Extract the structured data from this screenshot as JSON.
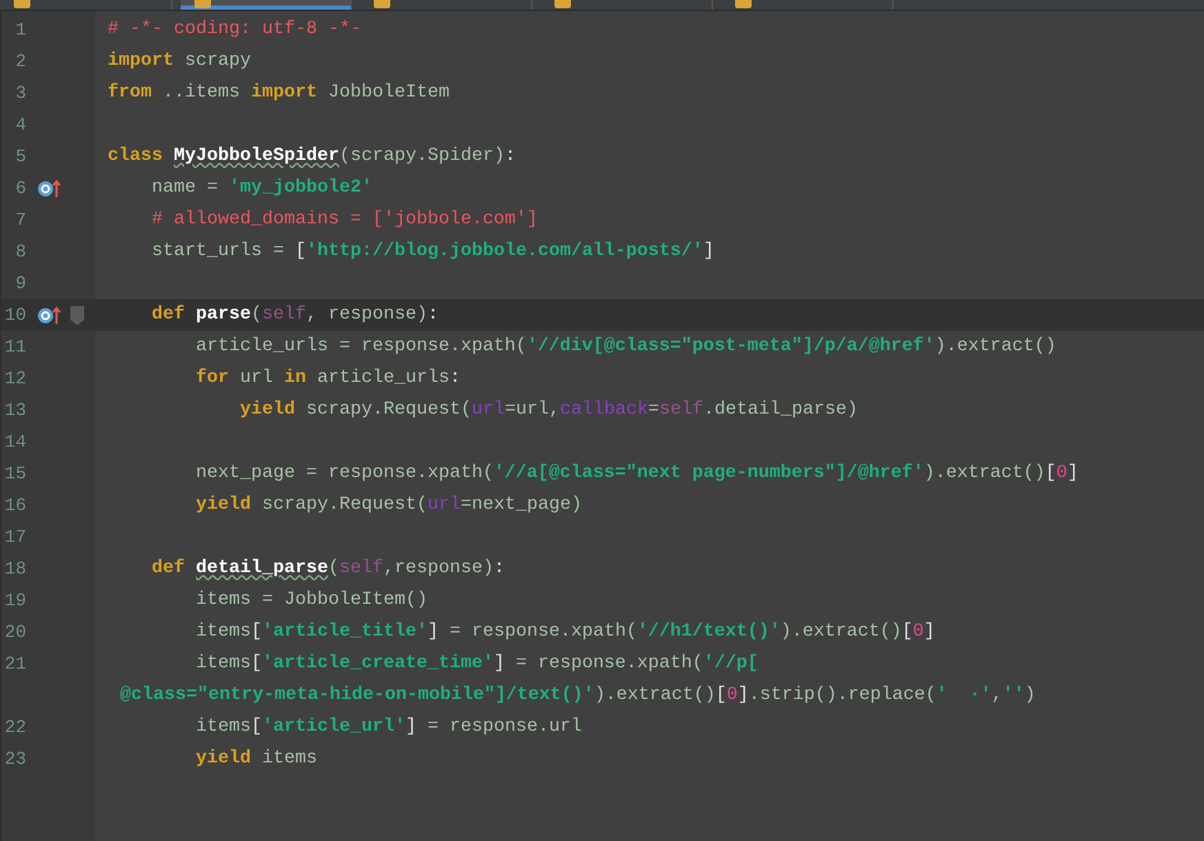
{
  "tabs": [
    {
      "selected": false
    },
    {
      "selected": true
    },
    {
      "selected": false
    },
    {
      "selected": false
    },
    {
      "selected": false
    }
  ],
  "lines": [
    {
      "number": "1",
      "tokens": [
        {
          "kind": "comment",
          "text": "# -*- coding: utf-8 -*-"
        }
      ]
    },
    {
      "number": "2",
      "tokens": [
        {
          "kind": "keyword",
          "text": "import"
        },
        {
          "kind": "plain",
          "text": " scrapy"
        }
      ]
    },
    {
      "number": "3",
      "tokens": [
        {
          "kind": "keyword",
          "text": "from"
        },
        {
          "kind": "plain",
          "text": " ..items "
        },
        {
          "kind": "keyword",
          "text": "import"
        },
        {
          "kind": "plain",
          "text": " JobboleItem"
        }
      ]
    },
    {
      "number": "4"
    },
    {
      "number": "5",
      "tokens": [
        {
          "kind": "keyword",
          "text": "class "
        },
        {
          "kind": "defname",
          "text": "MyJobboleSpider",
          "misspelled": true
        },
        {
          "kind": "plain",
          "text": "(scrapy.Spider)"
        },
        {
          "kind": "punct",
          "text": ":"
        }
      ]
    },
    {
      "number": "6",
      "kind": "override",
      "tokens": [
        {
          "kind": "plain",
          "text": "    name = "
        },
        {
          "kind": "string",
          "text": "'my_jobbole2'"
        }
      ]
    },
    {
      "number": "7",
      "tokens": [
        {
          "kind": "comment",
          "text": "    # allowed_domains = ['jobbole.com']"
        }
      ]
    },
    {
      "number": "8",
      "tokens": [
        {
          "kind": "plain",
          "text": "    start_urls = "
        },
        {
          "kind": "punct",
          "text": "["
        },
        {
          "kind": "string",
          "text": "'http://blog.jobbole.com/all-posts/'"
        },
        {
          "kind": "punct",
          "text": "]"
        }
      ]
    },
    {
      "number": "9"
    },
    {
      "number": "10",
      "kind": "override",
      "current": true,
      "fold": true,
      "tokens": [
        {
          "kind": "keyword",
          "text": "    def "
        },
        {
          "kind": "defname",
          "text": "parse",
          "misspelled": false
        },
        {
          "kind": "plain",
          "text": "("
        },
        {
          "kind": "self",
          "text": "self"
        },
        {
          "kind": "plain",
          "text": ", response)"
        },
        {
          "kind": "punct",
          "text": ":"
        }
      ]
    },
    {
      "number": "11",
      "tokens": [
        {
          "kind": "plain",
          "text": "        article_urls = response.xpath("
        },
        {
          "kind": "string",
          "text": "'//div[@class=\"post-meta\"]/p/a/@href'"
        },
        {
          "kind": "plain",
          "text": ").extract()"
        }
      ]
    },
    {
      "number": "12",
      "tokens": [
        {
          "kind": "keyword",
          "text": "        for"
        },
        {
          "kind": "plain",
          "text": " url "
        },
        {
          "kind": "keyword",
          "text": "in"
        },
        {
          "kind": "plain",
          "text": " article_urls"
        },
        {
          "kind": "punct",
          "text": ":"
        }
      ]
    },
    {
      "number": "13",
      "tokens": [
        {
          "kind": "keyword",
          "text": "            yield"
        },
        {
          "kind": "plain",
          "text": " scrapy.Request("
        },
        {
          "kind": "param",
          "text": "url"
        },
        {
          "kind": "plain",
          "text": "=url,"
        },
        {
          "kind": "param",
          "text": "callback"
        },
        {
          "kind": "plain",
          "text": "="
        },
        {
          "kind": "self",
          "text": "self"
        },
        {
          "kind": "plain",
          "text": ".detail_parse)"
        }
      ]
    },
    {
      "number": "14"
    },
    {
      "number": "15",
      "tokens": [
        {
          "kind": "plain",
          "text": "        next_page = response.xpath("
        },
        {
          "kind": "string",
          "text": "'//a[@class=\"next page-numbers\"]/@href'"
        },
        {
          "kind": "plain",
          "text": ").extract()"
        },
        {
          "kind": "punct",
          "text": "["
        },
        {
          "kind": "number",
          "text": "0"
        },
        {
          "kind": "punct",
          "text": "]"
        }
      ]
    },
    {
      "number": "16",
      "tokens": [
        {
          "kind": "keyword",
          "text": "        yield"
        },
        {
          "kind": "plain",
          "text": " scrapy.Request("
        },
        {
          "kind": "param",
          "text": "url"
        },
        {
          "kind": "plain",
          "text": "=next_page)"
        }
      ]
    },
    {
      "number": "17"
    },
    {
      "number": "18",
      "tokens": [
        {
          "kind": "keyword",
          "text": "    def "
        },
        {
          "kind": "defname",
          "text": "detail_parse",
          "misspelled": true
        },
        {
          "kind": "plain",
          "text": "("
        },
        {
          "kind": "self",
          "text": "self"
        },
        {
          "kind": "plain",
          "text": ",response)"
        },
        {
          "kind": "punct",
          "text": ":"
        }
      ]
    },
    {
      "number": "19",
      "tokens": [
        {
          "kind": "plain",
          "text": "        items = JobboleItem()"
        }
      ]
    },
    {
      "number": "20",
      "tokens": [
        {
          "kind": "plain",
          "text": "        items"
        },
        {
          "kind": "punct",
          "text": "["
        },
        {
          "kind": "string",
          "text": "'article_title'"
        },
        {
          "kind": "punct",
          "text": "]"
        },
        {
          "kind": "plain",
          "text": " = response.xpath("
        },
        {
          "kind": "string",
          "text": "'//h1/text()'"
        },
        {
          "kind": "plain",
          "text": ").extract()"
        },
        {
          "kind": "punct",
          "text": "["
        },
        {
          "kind": "number",
          "text": "0"
        },
        {
          "kind": "punct",
          "text": "]"
        }
      ]
    },
    {
      "number": "21",
      "tokens": [
        {
          "kind": "plain",
          "text": "        items"
        },
        {
          "kind": "punct",
          "text": "["
        },
        {
          "kind": "string",
          "text": "'article_create_time'"
        },
        {
          "kind": "punct",
          "text": "]"
        },
        {
          "kind": "plain",
          "text": " = response.xpath("
        },
        {
          "kind": "string",
          "text": "'//p["
        }
      ]
    },
    {
      "kind": "continuation",
      "tokens": [
        {
          "kind": "string",
          "text": "@class=\"entry-meta-hide-on-mobile\"]/text()'"
        },
        {
          "kind": "plain",
          "text": ").extract()"
        },
        {
          "kind": "punct",
          "text": "["
        },
        {
          "kind": "number",
          "text": "0"
        },
        {
          "kind": "punct",
          "text": "]"
        },
        {
          "kind": "plain",
          "text": ".strip().replace("
        },
        {
          "kind": "string",
          "text": "'  ·'"
        },
        {
          "kind": "plain",
          "text": ","
        },
        {
          "kind": "string",
          "text": "''"
        },
        {
          "kind": "plain",
          "text": ")"
        }
      ]
    },
    {
      "number": "22",
      "tokens": [
        {
          "kind": "plain",
          "text": "        items"
        },
        {
          "kind": "punct",
          "text": "["
        },
        {
          "kind": "string",
          "text": "'article_url'"
        },
        {
          "kind": "punct",
          "text": "]"
        },
        {
          "kind": "plain",
          "text": " = response.url"
        }
      ]
    },
    {
      "number": "23",
      "tokens": [
        {
          "kind": "keyword",
          "text": "        yield"
        },
        {
          "kind": "plain",
          "text": " items"
        }
      ]
    }
  ]
}
